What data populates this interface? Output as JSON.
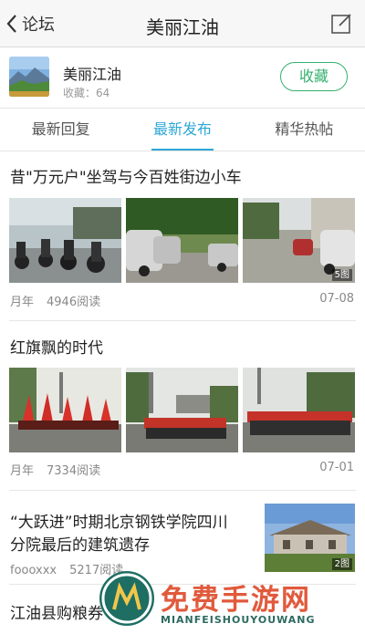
{
  "nav": {
    "back_label": "论坛",
    "title": "美丽江油",
    "compose_icon": "compose-icon"
  },
  "forum": {
    "name": "美丽江油",
    "favorites": "收藏：64",
    "collect_label": "收藏"
  },
  "tabs": [
    {
      "label": "最新回复",
      "active": false
    },
    {
      "label": "最新发布",
      "active": true
    },
    {
      "label": "精华热帖",
      "active": false
    }
  ],
  "posts": [
    {
      "title": "昔\"万元户\"坐驾与今百姓街边小车",
      "author": "月年",
      "reads": "4946阅读",
      "date": "07-08",
      "image_count": "5图"
    },
    {
      "title": "红旗飘的时代",
      "author": "月年",
      "reads": "7334阅读",
      "date": "07-01"
    },
    {
      "title_line1": "“大跃进”时期北京钢铁学院四川",
      "title_line2": "分院最后的建筑遗存",
      "author": "foooxxx",
      "reads": "5217阅读",
      "image_count": "2图"
    },
    {
      "title": "江油县购粮券"
    }
  ],
  "watermark": {
    "text": "免费手游网",
    "sub": "MIANFEISHOUYOUWANG"
  },
  "colors": {
    "accent_blue": "#2da7d6",
    "accent_green": "#35b06e"
  }
}
